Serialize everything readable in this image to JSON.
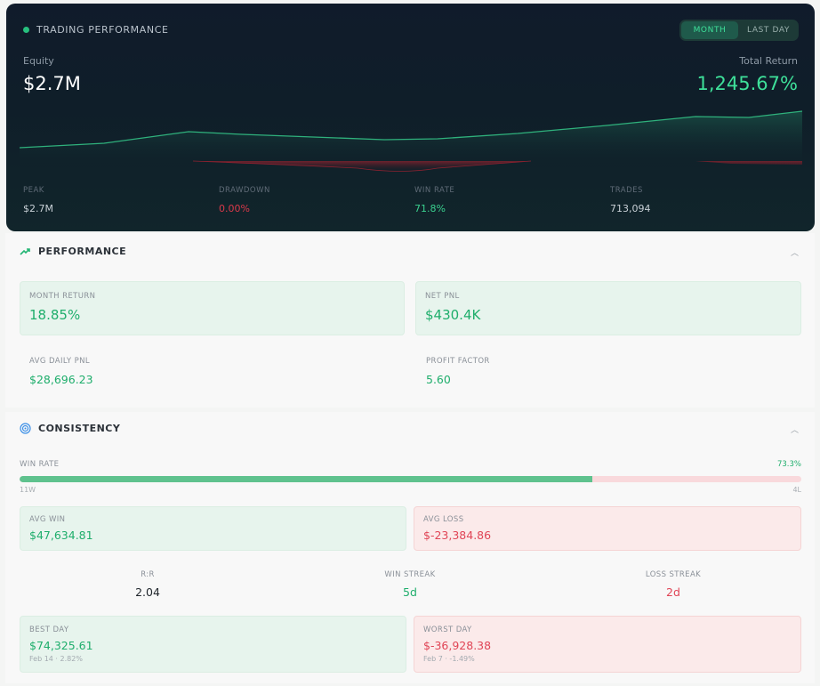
{
  "hero": {
    "title": "TRADING PERFORMANCE",
    "toggle": {
      "month": "MONTH",
      "last_day": "LAST DAY",
      "selected": "MONTH"
    },
    "equity_label": "Equity",
    "equity_value": "$2.7M",
    "total_return_label": "Total Return",
    "total_return_value": "1,245.67%",
    "stats": [
      {
        "label": "PEAK",
        "value": "$2.7M"
      },
      {
        "label": "DRAWDOWN",
        "value": "0.00%"
      },
      {
        "label": "WIN RATE",
        "value": "71.8%"
      },
      {
        "label": "TRADES",
        "value": "713,094"
      }
    ]
  },
  "performance": {
    "title": "PERFORMANCE",
    "month_return_label": "MONTH RETURN",
    "month_return_value": "18.85%",
    "net_pnl_label": "NET PNL",
    "net_pnl_value": "$430.4K",
    "avg_daily_pnl_label": "AVG DAILY PNL",
    "avg_daily_pnl_value": "$28,696.23",
    "profit_factor_label": "PROFIT FACTOR",
    "profit_factor_value": "5.60"
  },
  "consistency": {
    "title": "CONSISTENCY",
    "win_rate_label": "WIN RATE",
    "win_rate_value": "73.3%",
    "win_rate_fraction": 0.733,
    "wins_label": "11W",
    "losses_label": "4L",
    "avg_win_label": "AVG WIN",
    "avg_win_value": "$47,634.81",
    "avg_loss_label": "AVG LOSS",
    "avg_loss_value": "$-23,384.86",
    "rr_label": "R:R",
    "rr_value": "2.04",
    "win_streak_label": "WIN STREAK",
    "win_streak_value": "5d",
    "loss_streak_label": "LOSS STREAK",
    "loss_streak_value": "2d",
    "best_day_label": "BEST DAY",
    "best_day_value": "$74,325.61",
    "best_day_sub": "Feb 14 · 2.82%",
    "worst_day_label": "WORST DAY",
    "worst_day_value": "$-36,928.38",
    "worst_day_sub": "Feb 7 · -1.49%"
  },
  "colors": {
    "accent_green": "#3ee09a",
    "loss_red": "#e04556"
  }
}
